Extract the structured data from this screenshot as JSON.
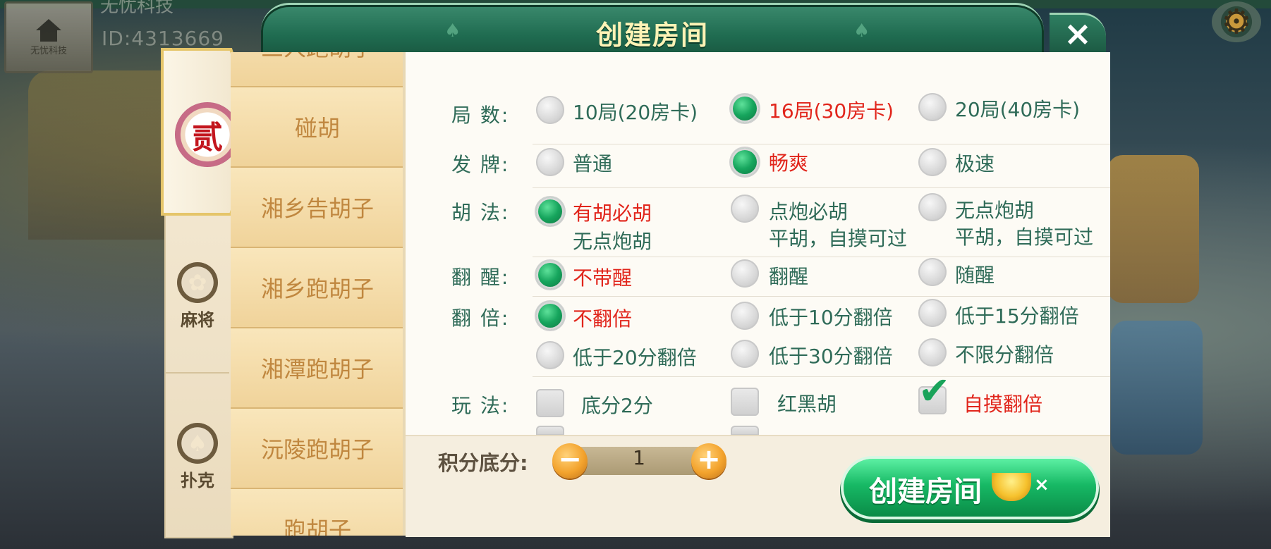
{
  "background": {
    "company_name": "无忧科技",
    "user_id": "ID:4313669",
    "logo_text": "无忧科技"
  },
  "dialog": {
    "title": "创建房间",
    "close_glyph": "×"
  },
  "categories": {
    "active_glyph": "贰",
    "items": [
      {
        "label": "麻将",
        "icon": "mahjong-flower-icon",
        "glyph": "✿"
      },
      {
        "label": "扑克",
        "icon": "spade-icon",
        "glyph": "♠"
      }
    ]
  },
  "game_list": [
    "三人跑胡子",
    "碰胡",
    "湘乡告胡子",
    "湘乡跑胡子",
    "湘潭跑胡子",
    "沅陵跑胡子",
    "跑胡子"
  ],
  "settings": {
    "rounds": {
      "label": "局  数:",
      "options": [
        "10局(20房卡)",
        "16局(30房卡)",
        "20局(40房卡)"
      ],
      "selected": "16局(30房卡)"
    },
    "deal": {
      "label": "发  牌:",
      "options": [
        "普通",
        "畅爽",
        "极速"
      ],
      "selected": "畅爽"
    },
    "hu_rule": {
      "label": "胡  法:",
      "options": [
        {
          "line1": "有胡必胡",
          "line2": "无点炮胡"
        },
        {
          "line1": "点炮必胡",
          "line2": "平胡，自摸可过"
        },
        {
          "line1": "无点炮胡",
          "line2": "平胡，自摸可过"
        }
      ],
      "selected": "有胡必胡"
    },
    "xing": {
      "label": "翻  醒:",
      "options": [
        "不带醒",
        "翻醒",
        "随醒"
      ],
      "selected": "不带醒"
    },
    "double": {
      "label": "翻  倍:",
      "options": [
        "不翻倍",
        "低于10分翻倍",
        "低于15分翻倍",
        "低于20分翻倍",
        "低于30分翻倍",
        "不限分翻倍"
      ],
      "selected": "不翻倍"
    },
    "play": {
      "label": "玩  法:",
      "options": [
        {
          "label": "底分2分",
          "checked": false
        },
        {
          "label": "红黑胡",
          "checked": false
        },
        {
          "label": "自摸翻倍",
          "checked": true
        }
      ]
    }
  },
  "score": {
    "label": "积分底分:",
    "value": "1",
    "minus_glyph": "−",
    "plus_glyph": "+"
  },
  "create_button": {
    "label": "创建房间",
    "multiplier": "×"
  },
  "colors": {
    "accent_green": "#16a55d",
    "selected_red": "#e1251b",
    "label_teal": "#2f6b58",
    "list_text": "#c0873f"
  }
}
